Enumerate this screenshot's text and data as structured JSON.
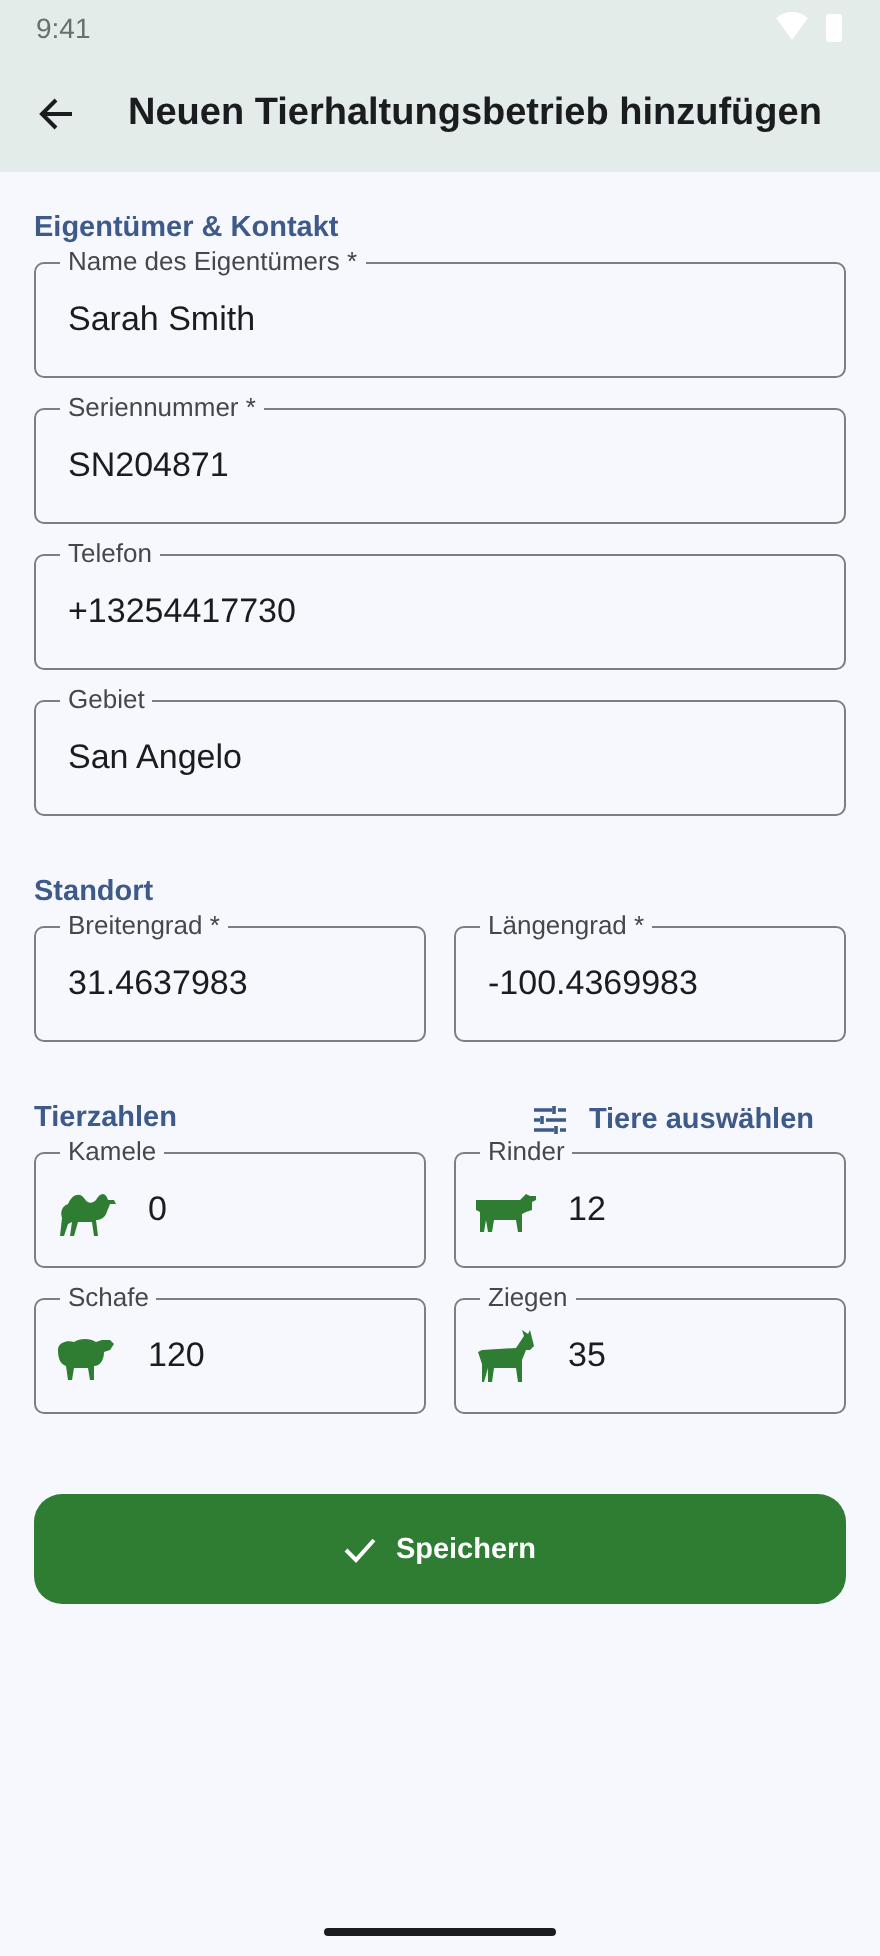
{
  "status_bar": {
    "time": "9:41"
  },
  "app_bar": {
    "title": "Neuen Tierhaltungsbetrieb hinzufügen"
  },
  "owner_section": {
    "title": "Eigentümer & Kontakt",
    "fields": [
      {
        "label": "Name des Eigentümers *",
        "value": "Sarah Smith"
      },
      {
        "label": "Seriennummer *",
        "value": "SN204871"
      },
      {
        "label": "Telefon",
        "value": "+13254417730"
      },
      {
        "label": "Gebiet",
        "value": "San Angelo"
      }
    ]
  },
  "location_section": {
    "title": "Standort",
    "fields": [
      {
        "label": "Breitengrad *",
        "value": "31.4637983"
      },
      {
        "label": "Längengrad *",
        "value": "-100.4369983"
      }
    ]
  },
  "animals_section": {
    "title": "Tierzahlen",
    "select_button": "Tiere auswählen",
    "fields": [
      {
        "kind": "camel",
        "label": "Kamele",
        "value": "0"
      },
      {
        "kind": "cow",
        "label": "Rinder",
        "value": "12"
      },
      {
        "kind": "sheep",
        "label": "Schafe",
        "value": "120"
      },
      {
        "kind": "goat",
        "label": "Ziegen",
        "value": "35"
      }
    ]
  },
  "save_button": "Speichern"
}
